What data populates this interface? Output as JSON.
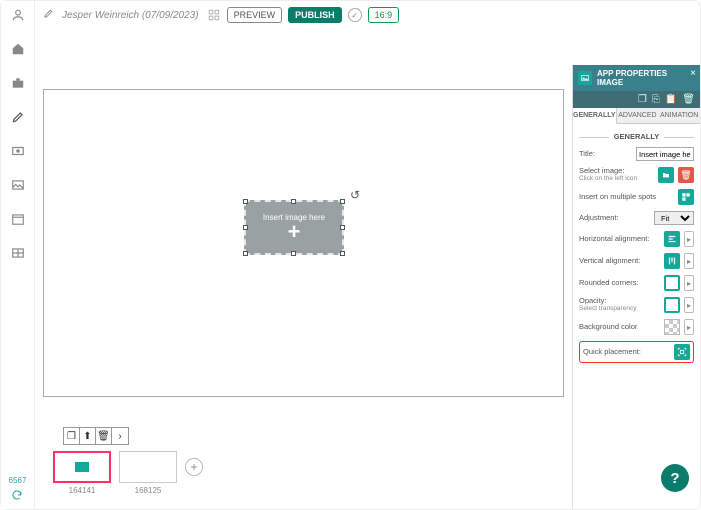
{
  "doc": {
    "title": "Jesper Weinreich (07/09/2023)"
  },
  "topbar": {
    "preview": "PREVIEW",
    "publish": "PUBLISH",
    "ratio": "16:9"
  },
  "rail": {
    "items": [
      "user",
      "home",
      "briefcase",
      "edit",
      "inbox",
      "image",
      "calendar",
      "table"
    ],
    "bottom_id": "6567"
  },
  "stage": {
    "placeholder_text": "Insert image here"
  },
  "thumbs": [
    {
      "id": "164141",
      "has_image": true,
      "active": true
    },
    {
      "id": "168125",
      "has_image": false,
      "active": false
    }
  ],
  "panel": {
    "title_line1": "APP PROPERTIES",
    "title_line2": "IMAGE",
    "tabs": {
      "generally": "GENERALLY",
      "advanced": "ADVANCED",
      "animation": "ANIMATION"
    },
    "section": "GENERALLY",
    "rows": {
      "title_label": "Title:",
      "title_value": "Insert image here",
      "select_image_label": "Select image:",
      "select_image_sub": "Click on the left icon",
      "multi_label": "Insert on multiple spots",
      "adjustment_label": "Adjustment:",
      "adjustment_value": "Fit",
      "halign_label": "Horizontal alignment:",
      "valign_label": "Vertical alignment:",
      "corners_label": "Rounded corners:",
      "opacity_label": "Opacity:",
      "opacity_sub": "Select transparency",
      "bgcolor_label": "Background color",
      "quick_label": "Quick placement:"
    }
  },
  "help": "?"
}
